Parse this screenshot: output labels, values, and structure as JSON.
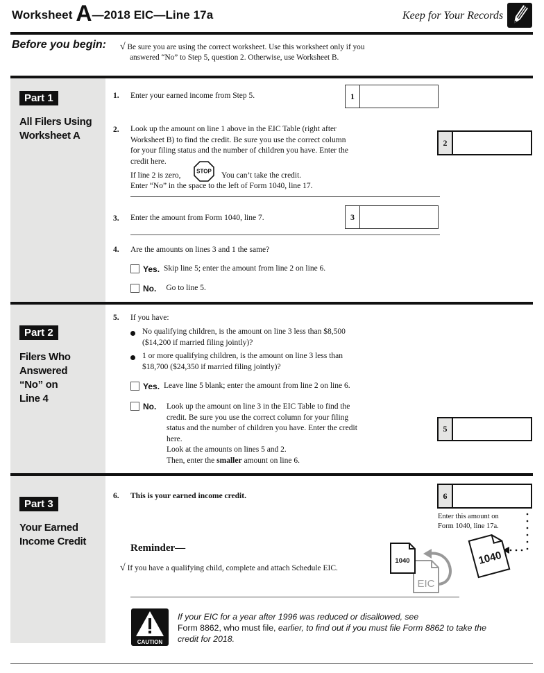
{
  "header": {
    "title_prefix": "Worksheet",
    "title_letter": "A",
    "title_suffix": "—2018 EIC—Line 17a",
    "keep": "Keep for Your Records",
    "icon": "pencil-icon"
  },
  "before_you_begin": {
    "label": "Before you begin:",
    "check": "√",
    "line1": "Be sure you are using the correct worksheet. Use this worksheet only if you",
    "line2": "answered “No” to Step 5, question 2. Otherwise, use Worksheet B."
  },
  "part1": {
    "badge": "Part 1",
    "title_line1": "All Filers Using",
    "title_line2": "Worksheet A",
    "line1": {
      "num": "1.",
      "text": "Enter your earned income from Step 5.",
      "box_label": "1",
      "value": ""
    },
    "line2": {
      "num": "2.",
      "text_lines": [
        "Look up the amount on line 1 above in the EIC Table (right after",
        "Worksheet B) to find the credit. Be sure you use the correct column",
        "for your filing status and the number of children you have. Enter the",
        "credit here."
      ],
      "if_zero": "If line 2 is zero,",
      "stop": "STOP",
      "cant_take": "You can’t take the credit.",
      "enter_no": "Enter “No” in the space to the left of Form 1040, line 17.",
      "box_label": "2",
      "value": ""
    },
    "line3": {
      "num": "3.",
      "text": "Enter the amount from Form 1040, line 7.",
      "box_label": "3",
      "value": ""
    },
    "line4": {
      "num": "4.",
      "text": "Are the amounts on lines 3 and 1 the same?",
      "yes_label": "Yes.",
      "yes_text": "Skip line 5; enter the amount from line 2 on line 6.",
      "no_label": "No.",
      "no_text": "Go to line 5."
    }
  },
  "part2": {
    "badge": "Part 2",
    "title_lines": [
      "Filers Who",
      "Answered",
      "“No” on",
      "Line 4"
    ],
    "line5": {
      "num": "5.",
      "intro": "If you have:",
      "bullet1_l1": "No qualifying children, is the amount on line 3 less than $8,500",
      "bullet1_l2": "($14,200 if married filing jointly)?",
      "bullet2_l1": "1 or more qualifying children, is the amount on line 3 less than",
      "bullet2_l2": "$18,700 ($24,350 if married filing jointly)?",
      "yes_label": "Yes.",
      "yes_text": "Leave line 5 blank; enter the amount from line 2 on line 6.",
      "no_label": "No.",
      "no_lines": [
        "Look up the amount on line 3 in the EIC Table to find the",
        "credit. Be sure you use the correct column for your filing",
        "status and the number of children you have. Enter the credit",
        "here.",
        "Look at the amounts on lines 5 and 2."
      ],
      "then_prefix": "Then, enter the ",
      "then_bold": "smaller",
      "then_suffix": " amount on line 6.",
      "box_label": "5",
      "value": ""
    }
  },
  "part3": {
    "badge": "Part 3",
    "title_line1": "Your Earned",
    "title_line2": "Income Credit",
    "line6": {
      "num": "6.",
      "text": "This is your earned income credit.",
      "box_label": "6",
      "value": "",
      "note_l1": "Enter this amount on",
      "note_l2": "Form 1040, line 17a."
    },
    "reminder_title": "Reminder—",
    "reminder_check": "√",
    "reminder_text": "If you have a qualifying child, complete and attach Schedule EIC.",
    "doc_1040_small": "1040",
    "doc_eic": "EIC",
    "doc_1040_large": "1040"
  },
  "caution": {
    "label": "CAUTION",
    "line1": "If your EIC for a year after 1996 was reduced or disallowed, see",
    "line2_normal": "Form 8862, who must file, ",
    "line2_italic": "earlier, to find out if you must file Form 8862 to take the",
    "line3": "credit for 2018."
  }
}
